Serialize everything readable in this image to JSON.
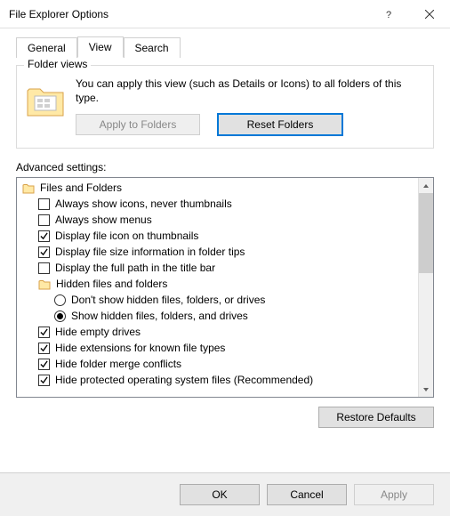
{
  "window": {
    "title": "File Explorer Options"
  },
  "tabs": {
    "general": "General",
    "view": "View",
    "search": "Search",
    "active": "view"
  },
  "folderViews": {
    "legend": "Folder views",
    "description": "You can apply this view (such as Details or Icons) to all folders of this type.",
    "applyBtn": "Apply to Folders",
    "resetBtn": "Reset Folders"
  },
  "advanced": {
    "label": "Advanced settings:",
    "root": "Files and Folders",
    "items": [
      {
        "type": "check",
        "checked": false,
        "label": "Always show icons, never thumbnails"
      },
      {
        "type": "check",
        "checked": false,
        "label": "Always show menus"
      },
      {
        "type": "check",
        "checked": true,
        "label": "Display file icon on thumbnails"
      },
      {
        "type": "check",
        "checked": true,
        "label": "Display file size information in folder tips"
      },
      {
        "type": "check",
        "checked": false,
        "label": "Display the full path in the title bar"
      },
      {
        "type": "folder",
        "label": "Hidden files and folders"
      },
      {
        "type": "radio",
        "selected": false,
        "label": "Don't show hidden files, folders, or drives"
      },
      {
        "type": "radio",
        "selected": true,
        "label": "Show hidden files, folders, and drives"
      },
      {
        "type": "check",
        "checked": true,
        "label": "Hide empty drives"
      },
      {
        "type": "check",
        "checked": true,
        "label": "Hide extensions for known file types"
      },
      {
        "type": "check",
        "checked": true,
        "label": "Hide folder merge conflicts"
      },
      {
        "type": "check",
        "checked": true,
        "label": "Hide protected operating system files (Recommended)"
      }
    ],
    "restoreBtn": "Restore Defaults"
  },
  "footer": {
    "ok": "OK",
    "cancel": "Cancel",
    "apply": "Apply"
  }
}
